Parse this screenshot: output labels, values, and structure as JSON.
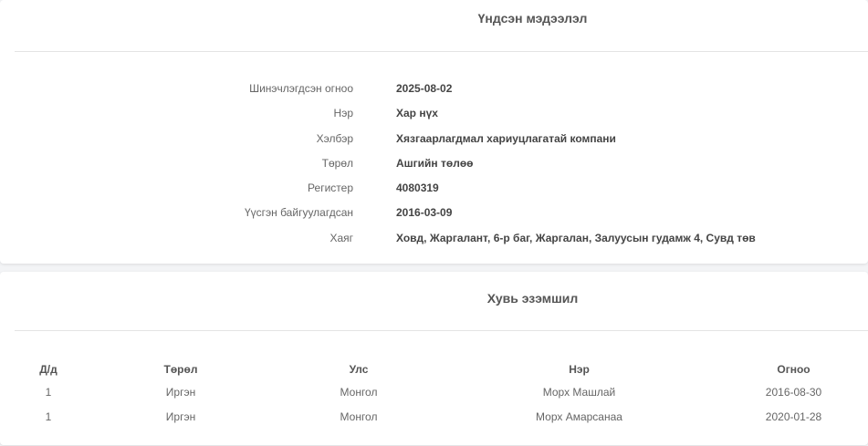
{
  "basic_info": {
    "title": "Үндсэн мэдээлэл",
    "rows": [
      {
        "label": "Шинэчлэгдсэн огноо",
        "value": "2025-08-02"
      },
      {
        "label": "Нэр",
        "value": "Хар нүх"
      },
      {
        "label": "Хэлбэр",
        "value": "Хязгаарлагдмал хариуцлагатай компани"
      },
      {
        "label": "Төрөл",
        "value": "Ашгийн төлөө"
      },
      {
        "label": "Регистер",
        "value": "4080319"
      },
      {
        "label": "Үүсгэн байгуулагдсан",
        "value": "2016-03-09"
      },
      {
        "label": "Хаяг",
        "value": "Ховд, Жаргалант, 6-р баг, Жаргалан, Залуусын гудамж 4, Сувд төв"
      }
    ]
  },
  "ownership": {
    "title": "Хувь эзэмшил",
    "columns": [
      "Д/д",
      "Төрөл",
      "Улс",
      "Нэр",
      "Огноо"
    ],
    "rows": [
      [
        "1",
        "Иргэн",
        "Монгол",
        "Морх Машлай",
        "2016-08-30"
      ],
      [
        "1",
        "Иргэн",
        "Монгол",
        "Морх Амарсанаа",
        "2020-01-28"
      ]
    ]
  }
}
